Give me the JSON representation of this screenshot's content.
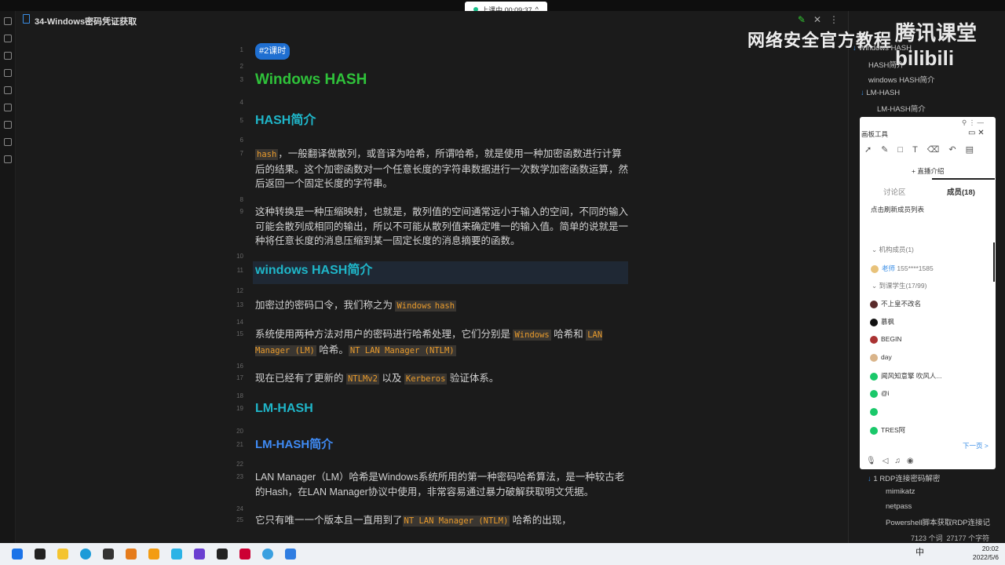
{
  "window": {
    "title": "34-Windows密码凭证获取"
  },
  "timer": {
    "label": "上课中 00:09:37",
    "chevron": "^"
  },
  "watermark": {
    "line1": "网络安全官方教程",
    "line2": "腾讯课堂 bilibili"
  },
  "editor": {
    "lines": [
      {
        "n": "1",
        "tag": "#2课时"
      },
      {
        "n": "2"
      },
      {
        "n": "3",
        "h1": "Windows HASH"
      },
      {
        "n": "4"
      },
      {
        "n": "5",
        "h2": "HASH简介"
      },
      {
        "n": "6"
      },
      {
        "n": "7",
        "code": "hash",
        "text": "，一般翻译做散列，或音译为哈希，所谓哈希，就是使用一种加密函数进行计算后的结果。这个加密函数对一个任意长度的字符串数据进行一次数学加密函数运算，然后返回一个固定长度的字符串。"
      },
      {
        "n": "8"
      },
      {
        "n": "9",
        "text": "这种转换是一种压缩映射，也就是，散列值的空间通常远小于输入的空间，不同的输入可能会散列成相同的输出，所以不可能从散列值来确定唯一的输入值。简单的说就是一种将任意长度的消息压缩到某一固定长度的消息摘要的函数。"
      },
      {
        "n": "10"
      },
      {
        "n": "11",
        "h2": "windows HASH简介"
      },
      {
        "n": "12"
      },
      {
        "n": "13",
        "c1": "Windows",
        "t1": " 加密过的密码口令，我们称之为 ",
        "c2": "hash"
      },
      {
        "n": "14"
      },
      {
        "n": "15",
        "c1": "Windows",
        "t1": " 系统使用两种方法对用户的密码进行哈希处理，它们分别是 ",
        "c2": "LAN Manager (LM)",
        "t2": " 哈希和 ",
        "c3": "NT LAN Manager (NTLM)",
        "t3": " 哈希。"
      },
      {
        "n": "16"
      },
      {
        "n": "17",
        "t1": "现在已经有了更新的 ",
        "c1": "NTLMv2",
        "t2": " 以及 ",
        "c2": "Kerberos",
        "t3": " 验证体系。"
      },
      {
        "n": "18"
      },
      {
        "n": "19",
        "h2": "LM-HASH"
      },
      {
        "n": "20"
      },
      {
        "n": "21",
        "h3": "LM-HASH简介"
      },
      {
        "n": "22"
      },
      {
        "n": "23",
        "text": "LAN Manager（LM）哈希是Windows系统所用的第一种密码哈希算法，是一种较古老的Hash，在LAN Manager协议中使用，非常容易通过暴力破解获取明文凭据。"
      },
      {
        "n": "24"
      },
      {
        "n": "25",
        "t1": "它只有唯一一个版本且一直用到了",
        "c1": "NT LAN Manager (NTLM)",
        "t2": " 哈希的出现，"
      }
    ]
  },
  "outline": {
    "items": [
      "Windows HASH",
      "HASH简介",
      "windows HASH简介",
      "LM-HASH",
      "LM-HASH简介",
      "1 RDP连接密码解密",
      "mimikatz",
      "netpass",
      "Powershell脚本获取RDP连接记"
    ]
  },
  "status": {
    "words": "7123 个词",
    "chars": "27177 个字符"
  },
  "panel": {
    "title": "画板工具",
    "intro": "+ 直播介绍",
    "tab_discuss": "讨论区",
    "tab_members": "成员(18)",
    "refresh": "点击刷新成员列表",
    "group_org": "机构成员(1)",
    "org_member": "155****1585",
    "group_students": "到课学生(17/99)",
    "members": [
      "不上皇不改名",
      "慕枫",
      "BEGIN",
      "day",
      "闻风知意擎 吹风人...",
      "@i",
      "",
      "TRES阿"
    ],
    "next": "下一页 >"
  },
  "tray": {
    "ime": "中",
    "time": "20:02",
    "date": "2022/5/6"
  }
}
